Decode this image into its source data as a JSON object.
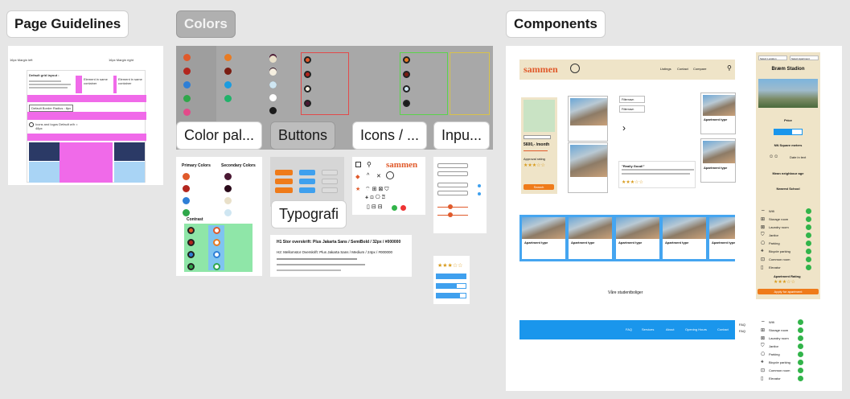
{
  "sections": {
    "page_guidelines": "Page Guidelines",
    "colors": "Colors",
    "components": "Components",
    "color_palette": "Color pal...",
    "buttons": "Buttons",
    "icons": "Icons / ...",
    "inputs": "Inpu...",
    "typography": "Typografi"
  },
  "guidelines": {
    "margin_left": "16px Margin left",
    "margin_right": "16px Margin right",
    "grid_title": "Default grid layout :",
    "element_same_container_a": "Element in same container",
    "element_same_container_b": "Element in same container",
    "default_border_radius": "Default Border Radius : 8px",
    "icons_and_logos": "Icons and logos Default w/h = 48px"
  },
  "color_palette": {
    "primary_title": "Primary Colors",
    "secondary_title": "Secondary Colors",
    "contrast_title": "Contrast"
  },
  "logo_text": "sammen",
  "typography": {
    "h1": "H1 Stor overskrift: Plus Jakarta Sans / SemiBold / 32px / #000000",
    "h2": "H2: Mellomstor Overskrift: Plus Jakarta Sans / Medium / 24px / #000000"
  },
  "components": {
    "nav_links": [
      "Listings",
      "Contact",
      "Compare"
    ],
    "price_label": "5600,- /month",
    "approval_label": "Approval rating",
    "search_button": "Search",
    "apartment_type": "Apartment type",
    "really_good": "\"Really Good!\"",
    "footer_links": [
      "FAQ",
      "Services",
      "About",
      "Opening Hours",
      "Contact"
    ],
    "footer_faq": [
      "FAQ",
      "FAQ"
    ],
    "vare": "Våre studentboliger",
    "detail_title": "Bræm Stadion",
    "select_location": "Select Location",
    "select_apartment": "Select Apartment",
    "price": "Price",
    "nb_square_meters": "NN Square meters",
    "date_in_text": "Date in text",
    "mean_neighbour_age": "Mean neighbour age",
    "nearest_school": "Nearest School",
    "apply_button": "Apply for apartment",
    "apartment_rating": "Apartment Rating",
    "amenities": [
      "Wifi",
      "Storage room",
      "Laundry room",
      "Janitor",
      "Parking",
      "Bicycle parking",
      "Common room",
      "Elevator"
    ],
    "filter_chips": [
      "Filternavn",
      "Filternavn"
    ]
  }
}
